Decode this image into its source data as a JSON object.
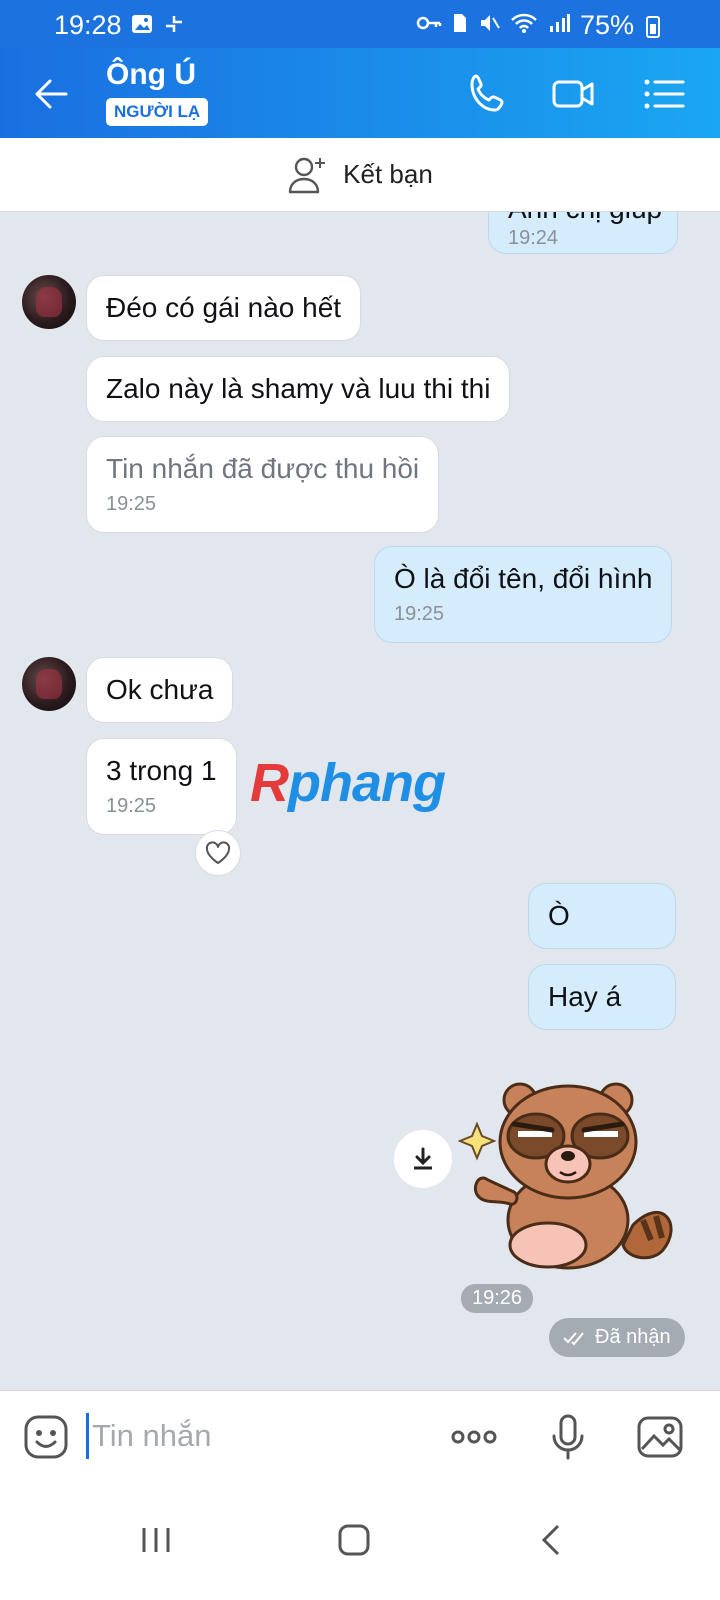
{
  "status": {
    "time": "19:28",
    "battery": "75%"
  },
  "header": {
    "title": "Ông Ú",
    "badge": "NGƯỜI LẠ"
  },
  "friend_bar": {
    "label": "Kết bạn"
  },
  "messages": [
    {
      "text": "Anh chị giúp",
      "time": "19:24"
    },
    {
      "text": "Đéo có gái nào hết"
    },
    {
      "text": "Zalo này là shamy và luu thi thi"
    },
    {
      "text": "Tin nhắn đã được thu hồi",
      "time": "19:25"
    },
    {
      "text": "Ò là đổi tên, đổi hình",
      "time": "19:25"
    },
    {
      "text": "Ok chưa"
    },
    {
      "text": "3 trong 1",
      "time": "19:25"
    },
    {
      "text": "Ò"
    },
    {
      "text": "Hay á"
    }
  ],
  "watermark": {
    "first": "R",
    "rest": "phang"
  },
  "sticker_time": "19:26",
  "received_label": "Đã nhận",
  "composer": {
    "placeholder": "Tin nhắn"
  }
}
